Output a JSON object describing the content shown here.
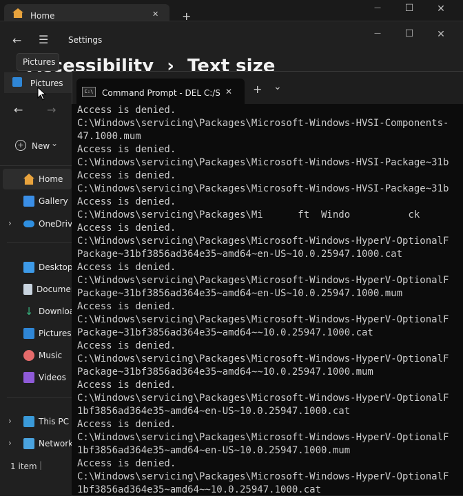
{
  "explorer_window": {
    "tab_title": "Home",
    "tab_close": "✕",
    "new_tab": "+",
    "address_tab_title": "Pictures",
    "toolbar": {
      "new_label": "New",
      "new_chevron": "⌄"
    },
    "sidebar": [
      {
        "label": "Home"
      },
      {
        "label": "Gallery"
      },
      {
        "label": "OneDrive"
      },
      {
        "label": "Desktop"
      },
      {
        "label": "Documents"
      },
      {
        "label": "Downloads"
      },
      {
        "label": "Pictures"
      },
      {
        "label": "Music"
      },
      {
        "label": "Videos"
      },
      {
        "label": "This PC"
      },
      {
        "label": "Network"
      }
    ],
    "status": "1 item",
    "status_sep": "|"
  },
  "settings_window": {
    "title": "Settings",
    "breadcrumb": "Accessibility",
    "breadcrumb_sep": "›",
    "page_title": "Text size",
    "tooltip": "Pictures"
  },
  "cmd_window": {
    "tab_title": "Command Prompt - DEL  C:/S",
    "tab_icon_text": "C:\\",
    "tab_close": "✕",
    "new_tab": "+",
    "dropdown": "⌄",
    "lines": [
      "Access is denied.",
      "C:\\Windows\\servicing\\Packages\\Microsoft-Windows-HVSI-Components-",
      "47.1000.mum",
      "Access is denied.",
      "C:\\Windows\\servicing\\Packages\\Microsoft-Windows-HVSI-Package~31b",
      "Access is denied.",
      "C:\\Windows\\servicing\\Packages\\Microsoft-Windows-HVSI-Package~31b",
      "Access is denied.",
      "C:\\Windows\\servicing\\Packages\\Mi      ft  Windo          ck",
      "Access is denied.",
      "C:\\Windows\\servicing\\Packages\\Microsoft-Windows-HyperV-OptionalF",
      "Package~31bf3856ad364e35~amd64~en-US~10.0.25947.1000.cat",
      "Access is denied.",
      "C:\\Windows\\servicing\\Packages\\Microsoft-Windows-HyperV-OptionalF",
      "Package~31bf3856ad364e35~amd64~en-US~10.0.25947.1000.mum",
      "Access is denied.",
      "C:\\Windows\\servicing\\Packages\\Microsoft-Windows-HyperV-OptionalF",
      "Package~31bf3856ad364e35~amd64~~10.0.25947.1000.cat",
      "Access is denied.",
      "C:\\Windows\\servicing\\Packages\\Microsoft-Windows-HyperV-OptionalF",
      "Package~31bf3856ad364e35~amd64~~10.0.25947.1000.mum",
      "Access is denied.",
      "C:\\Windows\\servicing\\Packages\\Microsoft-Windows-HyperV-OptionalF",
      "1bf3856ad364e35~amd64~en-US~10.0.25947.1000.cat",
      "Access is denied.",
      "C:\\Windows\\servicing\\Packages\\Microsoft-Windows-HyperV-OptionalF",
      "1bf3856ad364e35~amd64~en-US~10.0.25947.1000.mum",
      "Access is denied.",
      "C:\\Windows\\servicing\\Packages\\Microsoft-Windows-HyperV-OptionalF",
      "1bf3856ad364e35~amd64~~10.0.25947.1000.cat"
    ]
  },
  "window_controls": {
    "minimize": "—",
    "maximize": "☐",
    "close": "✕"
  },
  "colors": {
    "accent": "#4cc2ff",
    "console_bg": "#0c0c0c",
    "console_text": "#cccccc"
  }
}
